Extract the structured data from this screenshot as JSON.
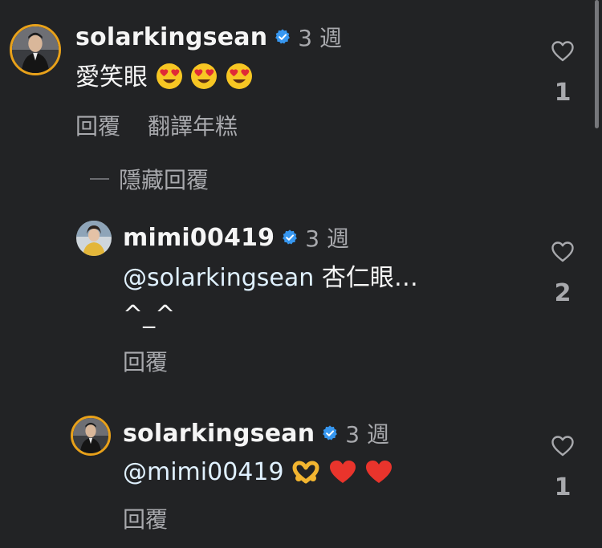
{
  "colors": {
    "background": "#222325",
    "text": "#f5f5f5",
    "secondary": "#a8a9ad",
    "verified": "#3797f0",
    "ring": "#e8a11a",
    "heart_red": "#e9342c"
  },
  "comments": [
    {
      "username": "solarkingsean",
      "time": "3 週",
      "text": "愛笑眼",
      "emojis": [
        "heart-eyes-emoji",
        "heart-eyes-emoji",
        "heart-eyes-emoji"
      ],
      "actions": [
        "回覆",
        "翻譯年糕"
      ],
      "likes": "1"
    }
  ],
  "hide_replies_label": "隱藏回覆",
  "replies": [
    {
      "username": "mimi00419",
      "time": "3 週",
      "mention": "@solarkingsean",
      "text_line1": "杏仁眼…",
      "text_line2": "^_^",
      "reply_label": "回覆",
      "likes": "2"
    },
    {
      "username": "solarkingsean",
      "time": "3 週",
      "mention": "@mimi00419",
      "emojis": [
        "heart-hands-emoji",
        "red-heart-emoji",
        "red-heart-emoji"
      ],
      "reply_label": "回覆",
      "likes": "1"
    }
  ]
}
